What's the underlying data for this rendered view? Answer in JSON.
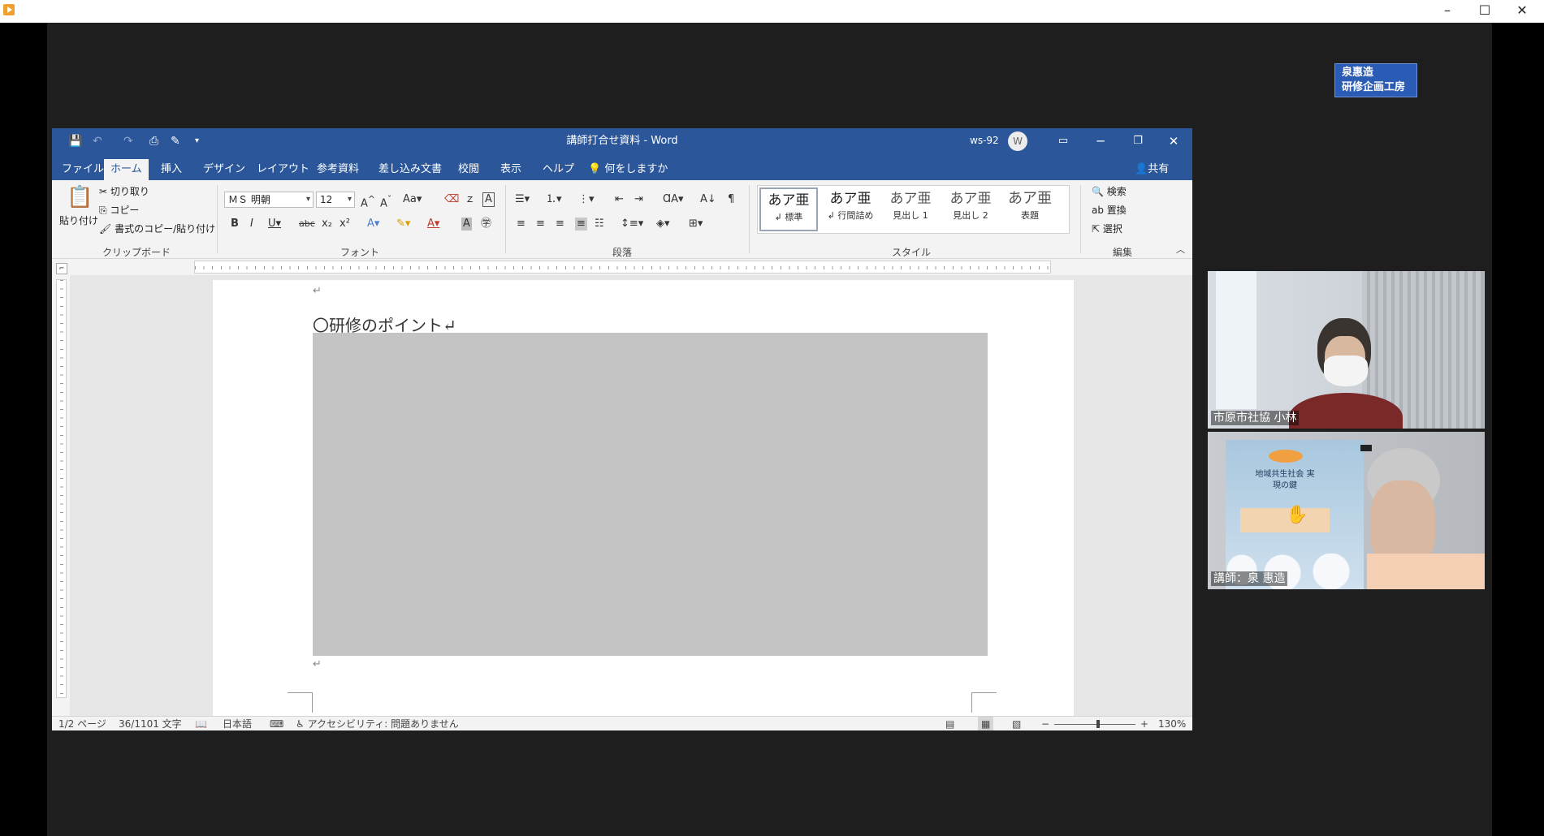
{
  "outer": {
    "controls": [
      "–",
      "☐",
      "✕"
    ]
  },
  "brand": {
    "line1": "泉惠造",
    "line2": "研修企画工房"
  },
  "word": {
    "title": "講師打合せ資料 - Word",
    "user": "ws-92",
    "avatar": "W",
    "qa_icons": [
      "💾",
      "↶",
      "↷",
      "⎙",
      "✎",
      "▾"
    ],
    "tabs": [
      "ファイル",
      "ホーム",
      "挿入",
      "デザイン",
      "レイアウト",
      "参考資料",
      "差し込み文書",
      "校閲",
      "表示",
      "ヘルプ"
    ],
    "active_tab": "ホーム",
    "tell_me": "何をしますか",
    "share": "共有",
    "clipboard": {
      "paste": "貼り付け",
      "cut": "切り取り",
      "copy": "コピー",
      "format_painter": "書式のコピー/貼り付け",
      "label": "クリップボード"
    },
    "font": {
      "name": "ＭＳ 明朝",
      "size": "12",
      "label": "フォント"
    },
    "paragraph": {
      "label": "段落"
    },
    "styles": {
      "items": [
        {
          "preview": "あア亜",
          "name": "↲ 標準"
        },
        {
          "preview": "あア亜",
          "name": "↲ 行間詰め"
        },
        {
          "preview": "あア亜",
          "name": "見出し 1"
        },
        {
          "preview": "あア亜",
          "name": "見出し 2"
        },
        {
          "preview": "あア亜",
          "name": "表題"
        }
      ],
      "label": "スタイル"
    },
    "editing": {
      "find": "検索",
      "replace": "置換",
      "select": "選択",
      "label": "編集"
    },
    "document": {
      "heading": "〇研修のポイント↵",
      "para_mark": "↵"
    },
    "status": {
      "page": "1/2 ページ",
      "words": "36/1101 文字",
      "language": "日本語",
      "accessibility": "アクセシビリティ: 問題ありません",
      "zoom": "130%"
    }
  },
  "participants": [
    {
      "name": "市原市社協  小林"
    },
    {
      "name": "講師：泉 惠造"
    }
  ],
  "book": {
    "title": "地域共生社会 実現の鍵"
  },
  "colors": {
    "word_blue": "#2b579a",
    "brand_blue": "#2a5bb5"
  }
}
